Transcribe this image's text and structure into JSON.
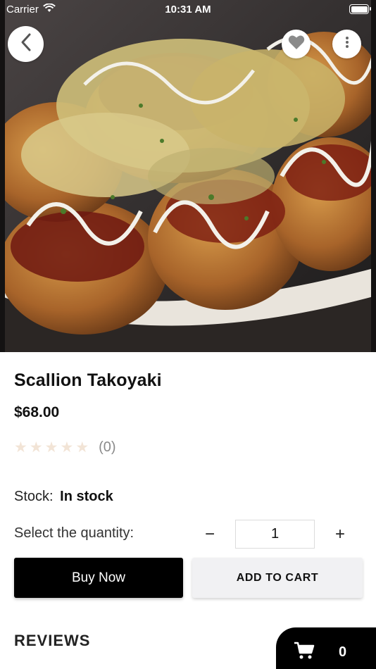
{
  "status_bar": {
    "carrier": "Carrier",
    "time": "10:31 AM"
  },
  "product": {
    "name": "Scallion Takoyaki",
    "price": "$68.00",
    "rating_stars": 0,
    "rating_count": "(0)",
    "stock_label": "Stock:",
    "stock_value": "In stock"
  },
  "quantity": {
    "label": "Select the quantity:",
    "minus": "−",
    "value": "1",
    "plus": "+"
  },
  "actions": {
    "buy_now": "Buy Now",
    "add_to_cart": "ADD TO CART"
  },
  "reviews": {
    "heading": "REVIEWS"
  },
  "cart": {
    "count": "0"
  },
  "icons": {
    "back": "chevron-left-icon",
    "favorite": "heart-icon",
    "more": "more-vertical-icon",
    "cart": "shopping-cart-icon",
    "wifi": "wifi-icon",
    "battery": "battery-icon"
  },
  "colors": {
    "primary_button": "#000000",
    "secondary_button": "#f1f1f3",
    "star_empty": "#f2e4d6",
    "heart": "#8a8a8a"
  }
}
